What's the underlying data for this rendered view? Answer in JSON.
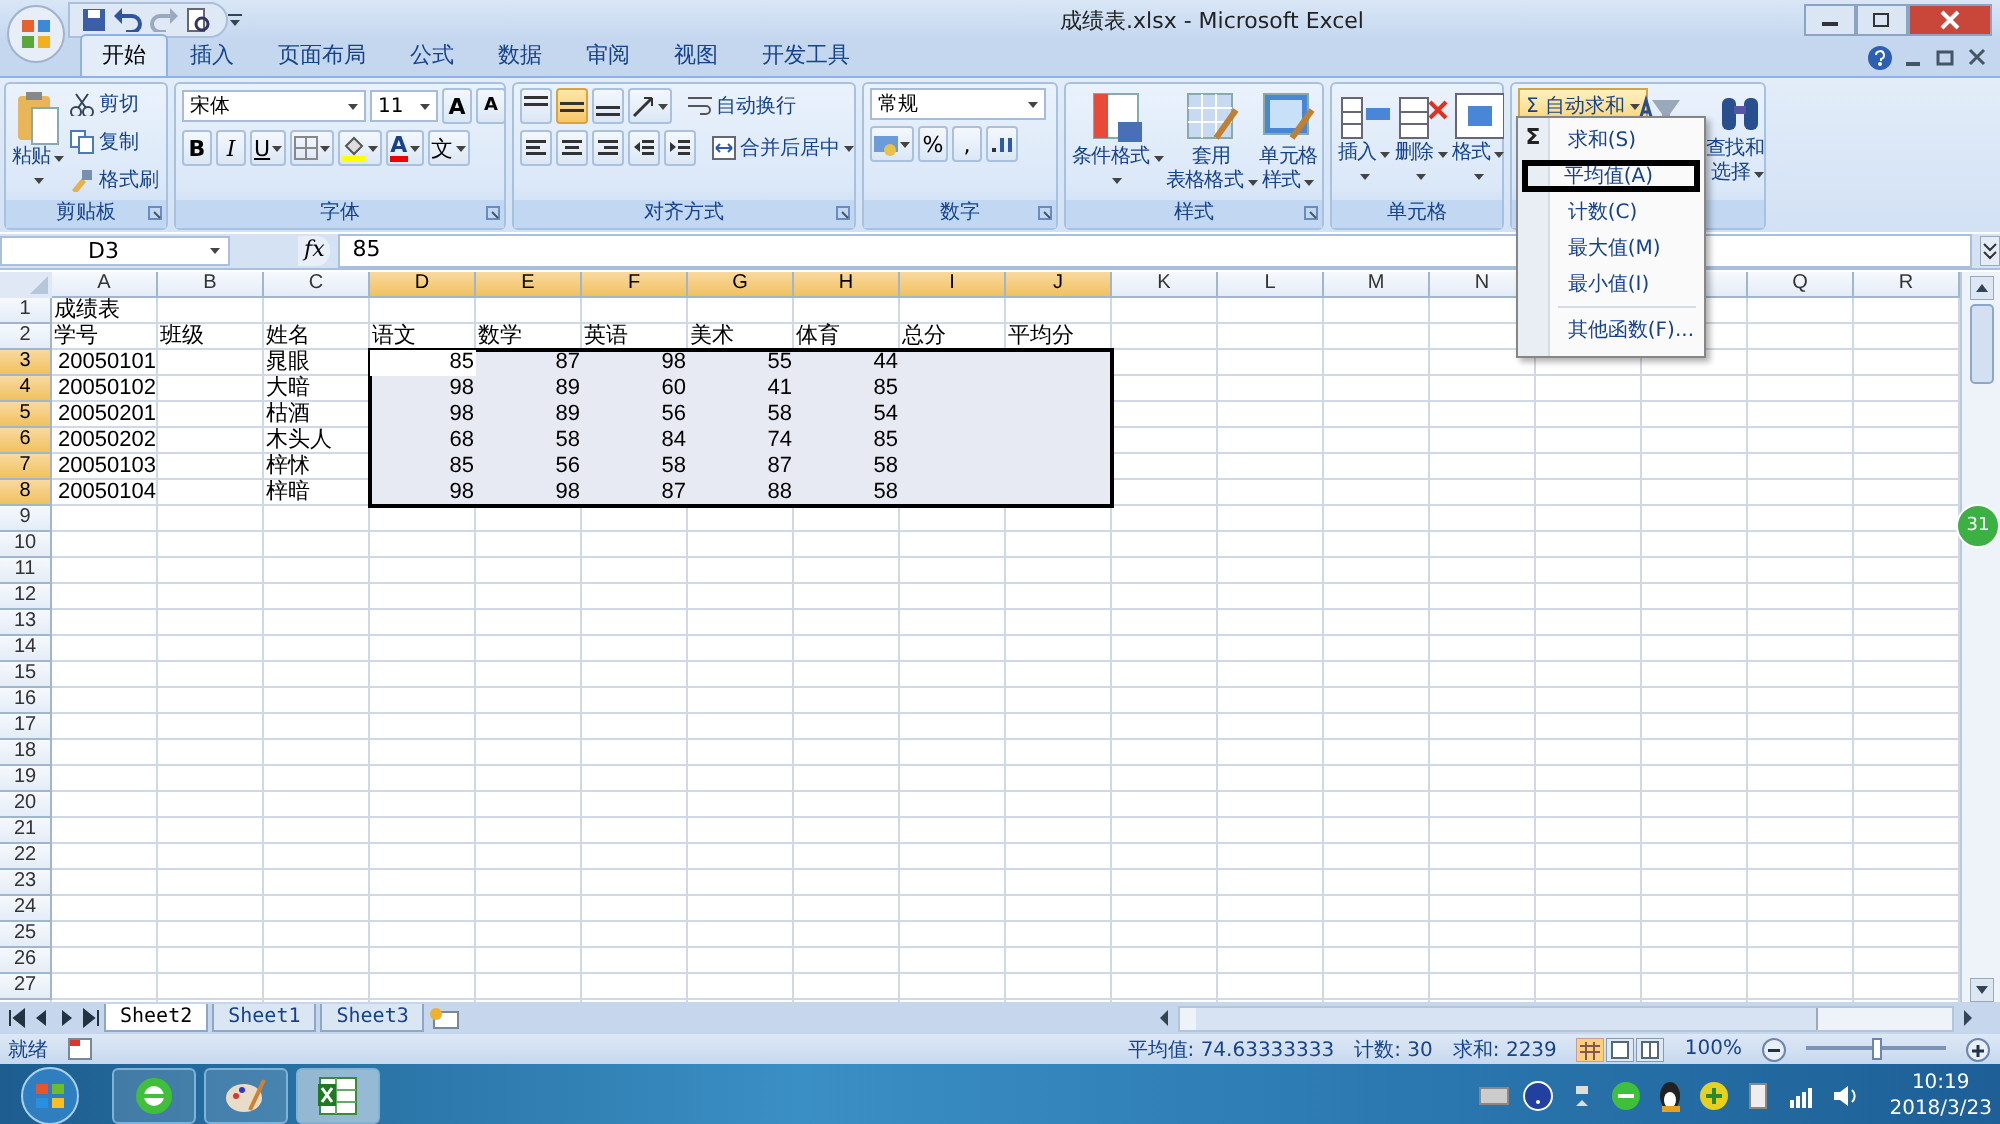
{
  "title_bar": {
    "title": "成绩表.xlsx - Microsoft Excel"
  },
  "ribbon_tabs": [
    {
      "label": "开始",
      "selected": true
    },
    {
      "label": "插入",
      "selected": false
    },
    {
      "label": "页面布局",
      "selected": false
    },
    {
      "label": "公式",
      "selected": false
    },
    {
      "label": "数据",
      "selected": false
    },
    {
      "label": "审阅",
      "selected": false
    },
    {
      "label": "视图",
      "selected": false
    },
    {
      "label": "开发工具",
      "selected": false
    }
  ],
  "ribbon": {
    "clipboard": {
      "label": "剪贴板",
      "paste": "粘贴",
      "cut": "剪切",
      "copy": "复制",
      "format_painter": "格式刷"
    },
    "font": {
      "label": "字体",
      "font_name": "宋体",
      "font_size": "11",
      "grow": "A",
      "shrink": "A",
      "bold": "B",
      "italic": "I",
      "underline": "U",
      "font_color": "A",
      "phonetic": "文"
    },
    "alignment": {
      "label": "对齐方式",
      "wrap_text": "自动换行",
      "merge_center": "合并后居中"
    },
    "number": {
      "label": "数字",
      "format": "常规",
      "percent": "%",
      "comma": ","
    },
    "styles": {
      "label": "样式",
      "buttons": [
        {
          "lines": [
            "条件格式"
          ]
        },
        {
          "lines": [
            "套用",
            "表格格式"
          ]
        },
        {
          "lines": [
            "单元格",
            "样式"
          ]
        }
      ]
    },
    "cells": {
      "label": "单元格",
      "buttons": [
        {
          "lines": [
            "插入"
          ],
          "kind": "insert"
        },
        {
          "lines": [
            "删除"
          ],
          "kind": "delete"
        },
        {
          "lines": [
            "格式"
          ],
          "kind": "format"
        }
      ]
    },
    "editing": {
      "autosum_symbol": "Σ",
      "autosum": "自动求和",
      "find_lines": [
        "查找和",
        "选择"
      ]
    }
  },
  "formula_bar": {
    "name_box": "D3",
    "fx": "fx",
    "formula": "85"
  },
  "grid": {
    "columns": [
      {
        "label": "A",
        "selected": false
      },
      {
        "label": "B",
        "selected": false
      },
      {
        "label": "C",
        "selected": false
      },
      {
        "label": "D",
        "selected": true
      },
      {
        "label": "E",
        "selected": true
      },
      {
        "label": "F",
        "selected": true
      },
      {
        "label": "G",
        "selected": true
      },
      {
        "label": "H",
        "selected": true
      },
      {
        "label": "I",
        "selected": true
      },
      {
        "label": "J",
        "selected": true
      },
      {
        "label": "K",
        "selected": false
      },
      {
        "label": "L",
        "selected": false
      },
      {
        "label": "M",
        "selected": false
      },
      {
        "label": "N",
        "selected": false
      }
    ],
    "columns_after_menu": [
      {
        "label": "Q",
        "selected": false
      },
      {
        "label": "R",
        "selected": false
      }
    ],
    "rows": [
      {
        "header": "1",
        "selected": false,
        "kind": "title",
        "cells": [
          "成绩表"
        ]
      },
      {
        "header": "2",
        "selected": false,
        "kind": "header",
        "cells": [
          "学号",
          "班级",
          "姓名",
          "语文",
          "数学",
          "英语",
          "美术",
          "体育",
          "总分",
          "平均分"
        ]
      },
      {
        "header": "3",
        "selected": true,
        "kind": "data",
        "cells": [
          "20050101",
          null,
          "晁眼",
          "85",
          "87",
          "98",
          "55",
          "44"
        ]
      },
      {
        "header": "4",
        "selected": true,
        "kind": "data",
        "cells": [
          "20050102",
          null,
          "大暗",
          "98",
          "89",
          "60",
          "41",
          "85"
        ]
      },
      {
        "header": "5",
        "selected": true,
        "kind": "data",
        "cells": [
          "20050201",
          null,
          "枯酒",
          "98",
          "89",
          "56",
          "58",
          "54"
        ]
      },
      {
        "header": "6",
        "selected": true,
        "kind": "data",
        "cells": [
          "20050202",
          null,
          "木头人",
          "68",
          "58",
          "84",
          "74",
          "85"
        ]
      },
      {
        "header": "7",
        "selected": true,
        "kind": "data",
        "cells": [
          "20050103",
          null,
          "梓怵",
          "85",
          "56",
          "58",
          "87",
          "58"
        ]
      },
      {
        "header": "8",
        "selected": true,
        "kind": "data",
        "cells": [
          "20050104",
          null,
          "梓暗",
          "98",
          "98",
          "87",
          "88",
          "58"
        ]
      },
      {
        "header": "9",
        "selected": false,
        "kind": "empty"
      },
      {
        "header": "10",
        "selected": false,
        "kind": "empty"
      },
      {
        "header": "11",
        "selected": false,
        "kind": "empty"
      },
      {
        "header": "12",
        "selected": false,
        "kind": "empty"
      },
      {
        "header": "13",
        "selected": false,
        "kind": "empty"
      },
      {
        "header": "14",
        "selected": false,
        "kind": "empty"
      },
      {
        "header": "15",
        "selected": false,
        "kind": "empty"
      },
      {
        "header": "16",
        "selected": false,
        "kind": "empty"
      },
      {
        "header": "17",
        "selected": false,
        "kind": "empty"
      },
      {
        "header": "18",
        "selected": false,
        "kind": "empty"
      },
      {
        "header": "19",
        "selected": false,
        "kind": "empty"
      },
      {
        "header": "20",
        "selected": false,
        "kind": "empty"
      },
      {
        "header": "21",
        "selected": false,
        "kind": "empty"
      },
      {
        "header": "22",
        "selected": false,
        "kind": "empty"
      },
      {
        "header": "23",
        "selected": false,
        "kind": "empty"
      },
      {
        "header": "24",
        "selected": false,
        "kind": "empty"
      },
      {
        "header": "25",
        "selected": false,
        "kind": "empty"
      },
      {
        "header": "26",
        "selected": false,
        "kind": "empty"
      },
      {
        "header": "27",
        "selected": false,
        "kind": "empty"
      }
    ]
  },
  "autosum_menu": {
    "symbol": "Σ",
    "items": [
      {
        "label": "求和(S)",
        "highlighted": false
      },
      {
        "label": "平均值(A)",
        "highlighted": true
      },
      {
        "label": "计数(C)",
        "highlighted": false
      },
      {
        "label": "最大值(M)",
        "highlighted": false
      },
      {
        "label": "最小值(I)",
        "highlighted": false
      },
      {
        "label": "其他函数(F)...",
        "highlighted": false
      }
    ]
  },
  "sheet_tabs": [
    {
      "label": "Sheet2",
      "selected": true
    },
    {
      "label": "Sheet1",
      "selected": false
    },
    {
      "label": "Sheet3",
      "selected": false
    }
  ],
  "status_bar": {
    "ready": "就绪",
    "average": "平均值: 74.63333333",
    "count": "计数: 30",
    "sum": "求和: 2239",
    "zoom": "100%",
    "zoom_level": {
      "level": 0.5
    }
  },
  "badge": "31",
  "taskbar": {
    "apps": [
      {
        "kind": "browser",
        "selected": false
      },
      {
        "kind": "paint",
        "selected": false
      },
      {
        "kind": "excel",
        "selected": true
      }
    ],
    "time": "10:19",
    "date": "2018/3/23"
  }
}
